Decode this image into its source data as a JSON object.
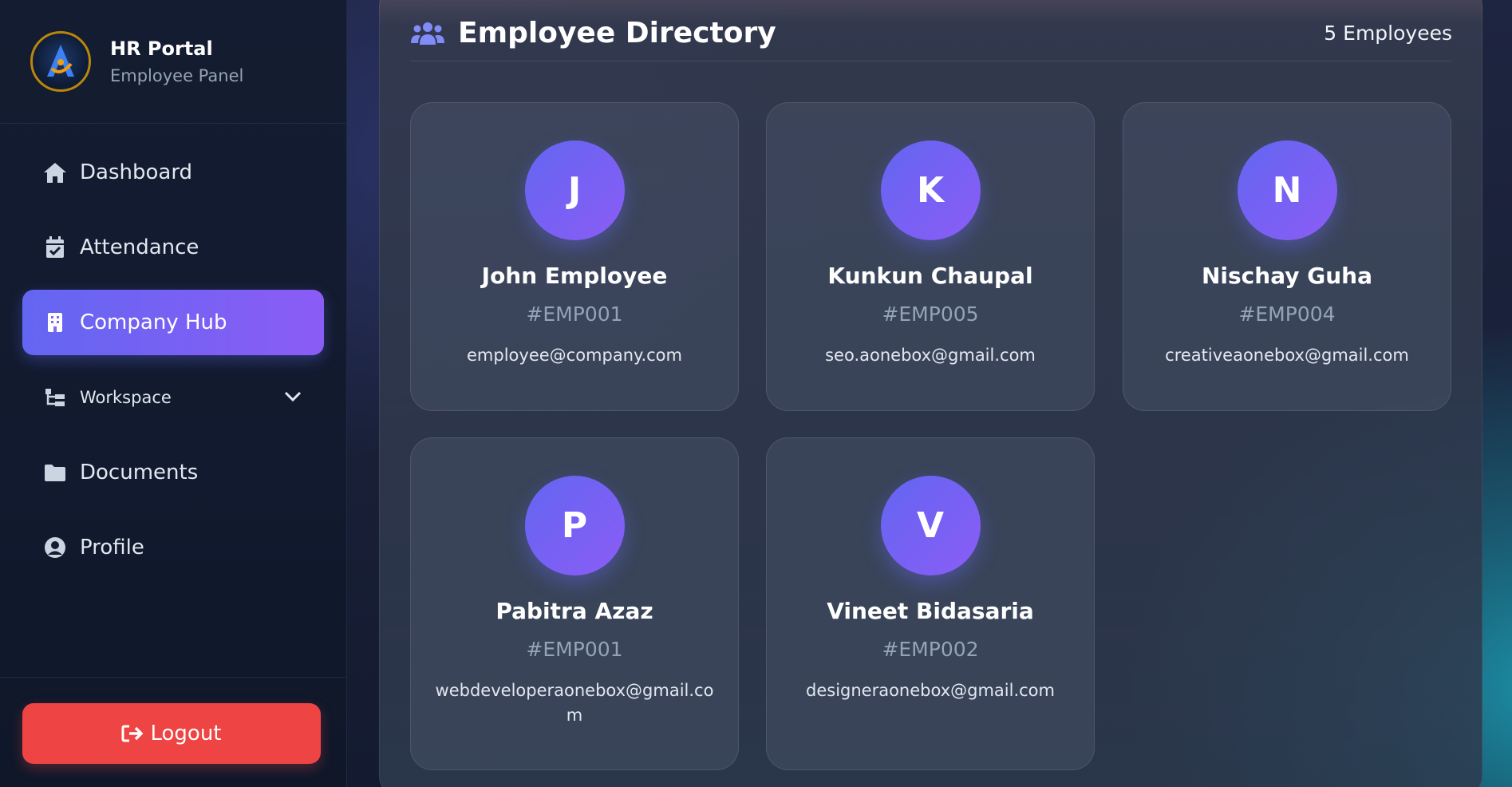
{
  "brand": {
    "title": "HR Portal",
    "subtitle": "Employee Panel"
  },
  "nav": {
    "items": [
      {
        "label": "Dashboard",
        "icon": "home-icon"
      },
      {
        "label": "Attendance",
        "icon": "calendar-check-icon"
      },
      {
        "label": "Company Hub",
        "icon": "building-icon",
        "active": true
      },
      {
        "label": "Workspace",
        "icon": "sitemap-icon"
      },
      {
        "label": "Documents",
        "icon": "folder-icon"
      },
      {
        "label": "Profile",
        "icon": "user-circle-icon"
      }
    ],
    "logout_label": "Logout"
  },
  "directory": {
    "title": "Employee Directory",
    "count_label": "5 Employees",
    "employees": [
      {
        "initial": "J",
        "name": "John Employee",
        "code": "#EMP001",
        "email": "employee@company.com"
      },
      {
        "initial": "K",
        "name": "Kunkun Chaupal",
        "code": "#EMP005",
        "email": "seo.aonebox@gmail.com"
      },
      {
        "initial": "N",
        "name": "Nischay Guha",
        "code": "#EMP004",
        "email": "creativeaonebox@gmail.com"
      },
      {
        "initial": "P",
        "name": "Pabitra Azaz",
        "code": "#EMP001",
        "email": "webdeveloperaonebox@gmail.com"
      },
      {
        "initial": "V",
        "name": "Vineet Bidasaria",
        "code": "#EMP002",
        "email": "designeraonebox@gmail.com"
      }
    ]
  },
  "colors": {
    "accent_start": "#6366f1",
    "accent_end": "#8b5cf6",
    "logout": "#ef4444"
  }
}
